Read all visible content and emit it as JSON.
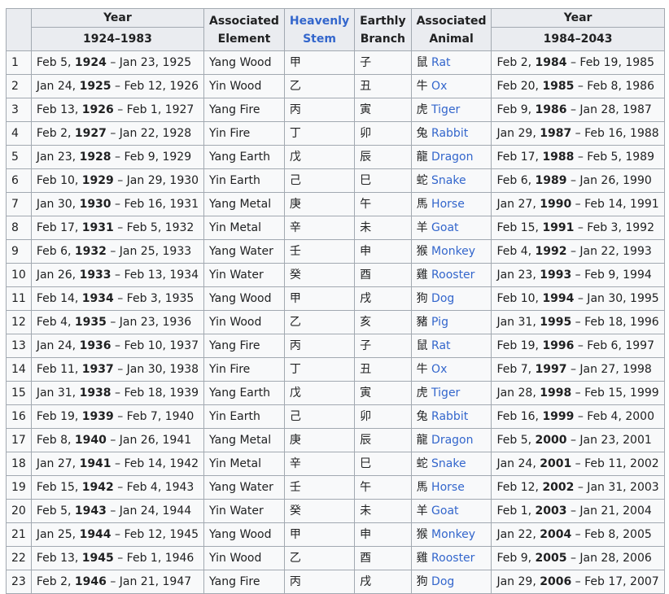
{
  "headers": {
    "year_a": "Year",
    "range_a": "1924–1983",
    "element": "Associated Element",
    "stem": "Heavenly Stem",
    "branch": "Earthly Branch",
    "animal": "Associated Animal",
    "year_b": "Year",
    "range_b": "1984–2043"
  },
  "rows": [
    {
      "n": "1",
      "a1": "Feb  5,",
      "ay": "1924",
      "a2": "– Jan 23, 1925",
      "el": "Yang Wood",
      "st": "甲",
      "br": "子",
      "ac": "鼠",
      "an": "Rat",
      "b1": "Feb  2,",
      "by": "1984",
      "b2": "– Feb 19, 1985"
    },
    {
      "n": "2",
      "a1": "Jan 24,",
      "ay": "1925",
      "a2": "– Feb 12, 1926",
      "el": "Yin Wood",
      "st": "乙",
      "br": "丑",
      "ac": "牛",
      "an": "Ox",
      "b1": "Feb 20,",
      "by": "1985",
      "b2": "– Feb  8, 1986"
    },
    {
      "n": "3",
      "a1": "Feb 13,",
      "ay": "1926",
      "a2": "– Feb  1, 1927",
      "el": "Yang Fire",
      "st": "丙",
      "br": "寅",
      "ac": "虎",
      "an": "Tiger",
      "b1": "Feb  9,",
      "by": "1986",
      "b2": "– Jan 28, 1987"
    },
    {
      "n": "4",
      "a1": "Feb  2,",
      "ay": "1927",
      "a2": "– Jan 22, 1928",
      "el": "Yin Fire",
      "st": "丁",
      "br": "卯",
      "ac": "兔",
      "an": "Rabbit",
      "b1": "Jan 29,",
      "by": "1987",
      "b2": "– Feb 16, 1988"
    },
    {
      "n": "5",
      "a1": "Jan 23,",
      "ay": "1928",
      "a2": "– Feb  9, 1929",
      "el": "Yang Earth",
      "st": "戊",
      "br": "辰",
      "ac": "龍",
      "an": "Dragon",
      "b1": "Feb 17,",
      "by": "1988",
      "b2": "– Feb  5, 1989"
    },
    {
      "n": "6",
      "a1": "Feb 10,",
      "ay": "1929",
      "a2": "– Jan 29, 1930",
      "el": "Yin Earth",
      "st": "己",
      "br": "巳",
      "ac": "蛇",
      "an": "Snake",
      "b1": "Feb  6,",
      "by": "1989",
      "b2": "– Jan 26, 1990"
    },
    {
      "n": "7",
      "a1": "Jan 30,",
      "ay": "1930",
      "a2": "– Feb 16, 1931",
      "el": "Yang Metal",
      "st": "庚",
      "br": "午",
      "ac": "馬",
      "an": "Horse",
      "b1": "Jan 27,",
      "by": "1990",
      "b2": "– Feb 14, 1991"
    },
    {
      "n": "8",
      "a1": "Feb 17,",
      "ay": "1931",
      "a2": "– Feb  5, 1932",
      "el": "Yin Metal",
      "st": "辛",
      "br": "未",
      "ac": "羊",
      "an": "Goat",
      "b1": "Feb 15,",
      "by": "1991",
      "b2": "– Feb  3, 1992"
    },
    {
      "n": "9",
      "a1": "Feb  6,",
      "ay": "1932",
      "a2": "– Jan 25, 1933",
      "el": "Yang Water",
      "st": "壬",
      "br": "申",
      "ac": "猴",
      "an": "Monkey",
      "b1": "Feb  4,",
      "by": "1992",
      "b2": "– Jan 22, 1993"
    },
    {
      "n": "10",
      "a1": "Jan 26,",
      "ay": "1933",
      "a2": "– Feb 13, 1934",
      "el": "Yin Water",
      "st": "癸",
      "br": "酉",
      "ac": "雞",
      "an": "Rooster",
      "b1": "Jan 23,",
      "by": "1993",
      "b2": "– Feb  9, 1994"
    },
    {
      "n": "11",
      "a1": "Feb 14,",
      "ay": "1934",
      "a2": "– Feb  3, 1935",
      "el": "Yang Wood",
      "st": "甲",
      "br": "戌",
      "ac": "狗",
      "an": "Dog",
      "b1": "Feb 10,",
      "by": "1994",
      "b2": "– Jan 30, 1995"
    },
    {
      "n": "12",
      "a1": "Feb  4,",
      "ay": "1935",
      "a2": "– Jan 23, 1936",
      "el": "Yin Wood",
      "st": "乙",
      "br": "亥",
      "ac": "豬",
      "an": "Pig",
      "b1": "Jan 31,",
      "by": "1995",
      "b2": "– Feb 18, 1996"
    },
    {
      "n": "13",
      "a1": "Jan 24,",
      "ay": "1936",
      "a2": "– Feb 10, 1937",
      "el": "Yang Fire",
      "st": "丙",
      "br": "子",
      "ac": "鼠",
      "an": "Rat",
      "b1": "Feb 19,",
      "by": "1996",
      "b2": "– Feb  6, 1997"
    },
    {
      "n": "14",
      "a1": "Feb 11,",
      "ay": "1937",
      "a2": "– Jan 30, 1938",
      "el": "Yin Fire",
      "st": "丁",
      "br": "丑",
      "ac": "牛",
      "an": "Ox",
      "b1": "Feb  7,",
      "by": "1997",
      "b2": "– Jan 27, 1998"
    },
    {
      "n": "15",
      "a1": "Jan 31,",
      "ay": "1938",
      "a2": "– Feb 18, 1939",
      "el": "Yang Earth",
      "st": "戊",
      "br": "寅",
      "ac": "虎",
      "an": "Tiger",
      "b1": "Jan 28,",
      "by": "1998",
      "b2": "– Feb 15, 1999"
    },
    {
      "n": "16",
      "a1": "Feb 19,",
      "ay": "1939",
      "a2": "– Feb  7, 1940",
      "el": "Yin Earth",
      "st": "己",
      "br": "卯",
      "ac": "兔",
      "an": "Rabbit",
      "b1": "Feb 16,",
      "by": "1999",
      "b2": "– Feb  4, 2000"
    },
    {
      "n": "17",
      "a1": "Feb  8,",
      "ay": "1940",
      "a2": "– Jan 26, 1941",
      "el": "Yang Metal",
      "st": "庚",
      "br": "辰",
      "ac": "龍",
      "an": "Dragon",
      "b1": "Feb  5,",
      "by": "2000",
      "b2": "– Jan 23, 2001"
    },
    {
      "n": "18",
      "a1": "Jan 27,",
      "ay": "1941",
      "a2": "– Feb 14, 1942",
      "el": "Yin Metal",
      "st": "辛",
      "br": "巳",
      "ac": "蛇",
      "an": "Snake",
      "b1": "Jan 24,",
      "by": "2001",
      "b2": "– Feb 11, 2002"
    },
    {
      "n": "19",
      "a1": "Feb 15,",
      "ay": "1942",
      "a2": "– Feb  4, 1943",
      "el": "Yang Water",
      "st": "壬",
      "br": "午",
      "ac": "馬",
      "an": "Horse",
      "b1": "Feb 12,",
      "by": "2002",
      "b2": "– Jan 31, 2003"
    },
    {
      "n": "20",
      "a1": "Feb  5,",
      "ay": "1943",
      "a2": "– Jan 24, 1944",
      "el": "Yin Water",
      "st": "癸",
      "br": "未",
      "ac": "羊",
      "an": "Goat",
      "b1": "Feb  1,",
      "by": "2003",
      "b2": "– Jan 21, 2004"
    },
    {
      "n": "21",
      "a1": "Jan 25,",
      "ay": "1944",
      "a2": "– Feb 12, 1945",
      "el": "Yang Wood",
      "st": "甲",
      "br": "申",
      "ac": "猴",
      "an": "Monkey",
      "b1": "Jan 22,",
      "by": "2004",
      "b2": "– Feb  8, 2005"
    },
    {
      "n": "22",
      "a1": "Feb 13,",
      "ay": "1945",
      "a2": "– Feb  1, 1946",
      "el": "Yin Wood",
      "st": "乙",
      "br": "酉",
      "ac": "雞",
      "an": "Rooster",
      "b1": "Feb  9,",
      "by": "2005",
      "b2": "– Jan 28, 2006"
    },
    {
      "n": "23",
      "a1": "Feb  2,",
      "ay": "1946",
      "a2": "– Jan 21, 1947",
      "el": "Yang Fire",
      "st": "丙",
      "br": "戌",
      "ac": "狗",
      "an": "Dog",
      "b1": "Jan 29,",
      "by": "2006",
      "b2": "– Feb 17, 2007"
    }
  ]
}
